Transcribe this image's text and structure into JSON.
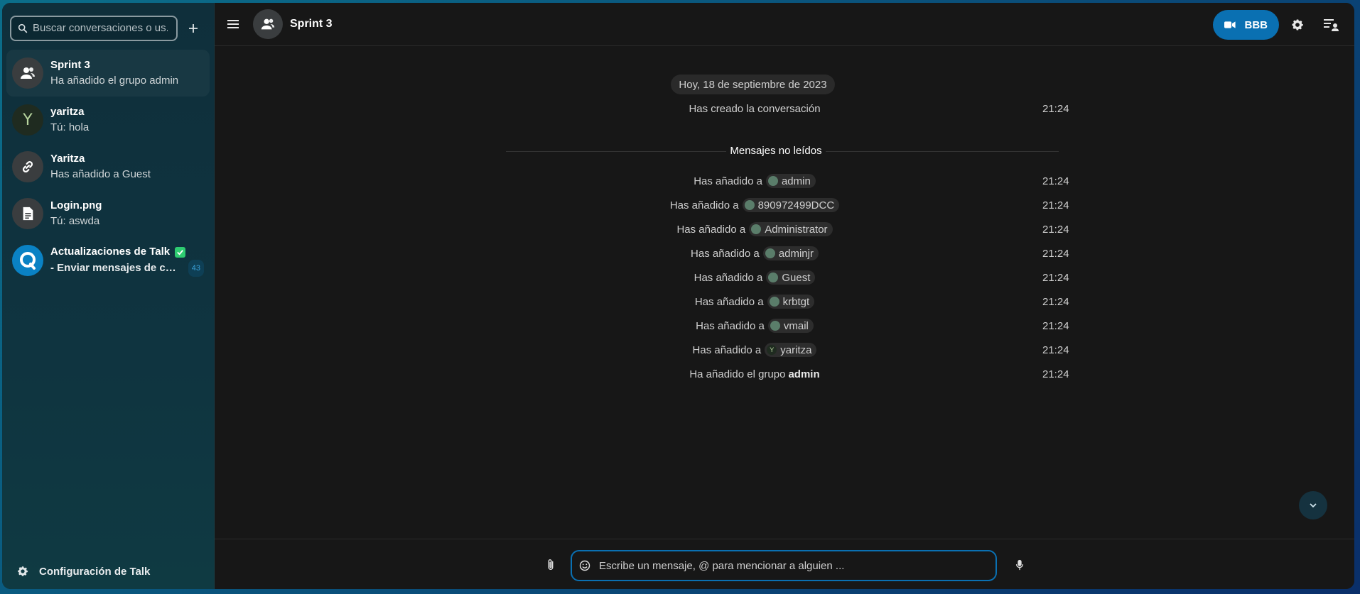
{
  "sidebar": {
    "search_placeholder": "Buscar conversaciones o us...",
    "conversations": [
      {
        "title": "Sprint 3",
        "subtitle": "Ha añadido el grupo admin",
        "avatar": "group-icon",
        "active": true
      },
      {
        "title": "yaritza",
        "subtitle": "Tú: hola",
        "avatar_letter": "Y"
      },
      {
        "title": "Yaritza",
        "subtitle": "Has añadido a Guest",
        "avatar": "link-icon"
      },
      {
        "title": "Login.png",
        "subtitle": "Tú: aswda",
        "avatar": "file-icon"
      },
      {
        "title": "Actualizaciones de Talk",
        "subtitle": "- Enviar mensajes de cha...",
        "avatar": "talk-logo-icon",
        "unread": "43",
        "verified": true
      }
    ],
    "settings_label": "Configuración de Talk"
  },
  "header": {
    "room_title": "Sprint 3",
    "call_label": "BBB"
  },
  "messages": {
    "date": "Hoy, 18 de septiembre de 2023",
    "unread_label": "Mensajes no leídos",
    "items": [
      {
        "text": "Has creado la conversación",
        "time": "21:24"
      },
      {
        "prefix": "Has añadido a",
        "mention": "admin",
        "time": "21:24"
      },
      {
        "prefix": "Has añadido a",
        "mention": "890972499DCC",
        "time": "21:24"
      },
      {
        "prefix": "Has añadido a",
        "mention": "Administrator",
        "time": "21:24"
      },
      {
        "prefix": "Has añadido a",
        "mention": "adminjr",
        "time": "21:24"
      },
      {
        "prefix": "Has añadido a",
        "mention": "Guest",
        "time": "21:24"
      },
      {
        "prefix": "Has añadido a",
        "mention": "krbtgt",
        "time": "21:24"
      },
      {
        "prefix": "Has añadido a",
        "mention": "vmail",
        "time": "21:24"
      },
      {
        "prefix": "Has añadido a",
        "mention": "yaritza",
        "time": "21:24",
        "mention_letter": "Y"
      },
      {
        "prefix": "Ha añadido el grupo",
        "bold": "admin",
        "time": "21:24"
      }
    ]
  },
  "composer": {
    "placeholder": "Escribe un mensaje, @ para mencionar a alguien ..."
  }
}
